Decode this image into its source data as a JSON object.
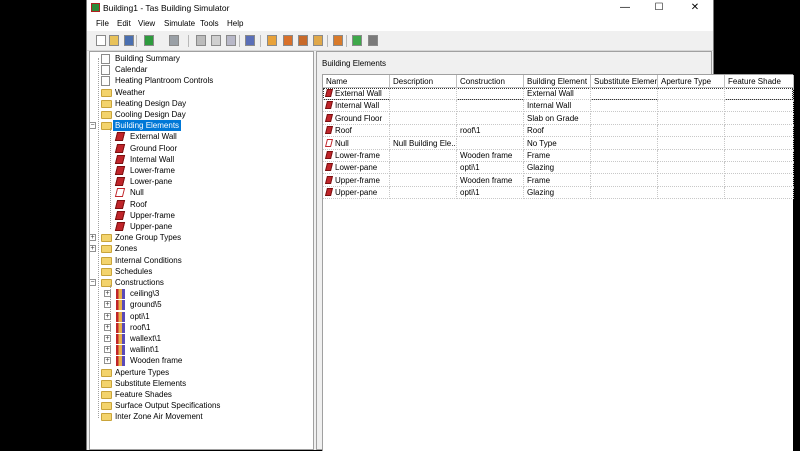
{
  "window": {
    "title": "Building1 - Tas Building Simulator"
  },
  "window_controls": {
    "minimize": "—",
    "maximize": "☐",
    "close": "✕"
  },
  "menu": [
    "File",
    "Edit",
    "View",
    "Simulate",
    "Tools",
    "Help"
  ],
  "toolbar": {
    "icons": [
      "new-file-icon",
      "open-folder-icon",
      "save-icon",
      "back-icon",
      "forward-icon",
      "cut-icon",
      "copy-icon",
      "paste-icon",
      "wizard-icon",
      "add-item-icon",
      "edit-item-icon",
      "properties-icon",
      "list-icon",
      "report-icon",
      "zone-icon",
      "refresh-icon"
    ]
  },
  "tree": {
    "root_items": [
      {
        "label": "Building Summary",
        "icon": "document-icon"
      },
      {
        "label": "Calendar",
        "icon": "calendar-icon"
      },
      {
        "label": "Heating Plantroom Controls",
        "icon": "plantroom-icon"
      },
      {
        "label": "Weather",
        "icon": "folder-icon"
      },
      {
        "label": "Heating Design Day",
        "icon": "folder-icon"
      },
      {
        "label": "Cooling Design Day",
        "icon": "folder-icon"
      },
      {
        "label": "Building Elements",
        "icon": "folder-icon",
        "expander": "⊟",
        "selected": true
      }
    ],
    "building_elements": [
      {
        "label": "External Wall",
        "icon": "building-element-icon"
      },
      {
        "label": "Ground Floor",
        "icon": "building-element-icon"
      },
      {
        "label": "Internal Wall",
        "icon": "building-element-icon"
      },
      {
        "label": "Lower-frame",
        "icon": "building-element-icon"
      },
      {
        "label": "Lower-pane",
        "icon": "building-element-icon"
      },
      {
        "label": "Null",
        "icon": "null-element-icon"
      },
      {
        "label": "Roof",
        "icon": "building-element-icon"
      },
      {
        "label": "Upper-frame",
        "icon": "building-element-icon"
      },
      {
        "label": "Upper-pane",
        "icon": "building-element-icon"
      }
    ],
    "middle_items": [
      {
        "label": "Zone Group Types",
        "expander": "⊞"
      },
      {
        "label": "Zones",
        "expander": "⊞"
      },
      {
        "label": "Internal Conditions",
        "expander": ""
      },
      {
        "label": "Schedules",
        "expander": ""
      },
      {
        "label": "Constructions",
        "expander": "⊟"
      }
    ],
    "constructions": [
      {
        "label": "ceiling\\3"
      },
      {
        "label": "ground\\5"
      },
      {
        "label": "opti\\1"
      },
      {
        "label": "roof\\1"
      },
      {
        "label": "wallext\\1"
      },
      {
        "label": "wallint\\1"
      },
      {
        "label": "Wooden frame"
      }
    ],
    "bottom_items": [
      {
        "label": "Aperture Types"
      },
      {
        "label": "Substitute Elements"
      },
      {
        "label": "Feature Shades"
      },
      {
        "label": "Surface Output Specifications"
      },
      {
        "label": "Inter Zone Air Movement"
      }
    ]
  },
  "pane": {
    "title": "Building Elements",
    "columns": [
      "Name",
      "Description",
      "Construction",
      "Building Element ...",
      "Substitute Element",
      "Aperture Type",
      "Feature Shade"
    ],
    "rows": [
      {
        "name": "External Wall",
        "description": "",
        "construction": "",
        "type": "External Wall",
        "substitute": "",
        "aperture": "",
        "shade": "",
        "icon": "building-element-icon"
      },
      {
        "name": "Internal Wall",
        "description": "",
        "construction": "",
        "type": "Internal Wall",
        "substitute": "",
        "aperture": "",
        "shade": "",
        "icon": "building-element-icon"
      },
      {
        "name": "Ground Floor",
        "description": "",
        "construction": "",
        "type": "Slab on Grade",
        "substitute": "",
        "aperture": "",
        "shade": "",
        "icon": "building-element-icon"
      },
      {
        "name": "Roof",
        "description": "",
        "construction": "roof\\1",
        "type": "Roof",
        "substitute": "",
        "aperture": "",
        "shade": "",
        "icon": "building-element-icon"
      },
      {
        "name": "Null",
        "description": "Null Building Ele...",
        "construction": "",
        "type": "No Type",
        "substitute": "",
        "aperture": "",
        "shade": "",
        "icon": "null-element-icon"
      },
      {
        "name": "Lower-frame",
        "description": "",
        "construction": "Wooden frame",
        "type": "Frame",
        "substitute": "",
        "aperture": "",
        "shade": "",
        "icon": "building-element-icon"
      },
      {
        "name": "Lower-pane",
        "description": "",
        "construction": "opti\\1",
        "type": "Glazing",
        "substitute": "",
        "aperture": "",
        "shade": "",
        "icon": "building-element-icon"
      },
      {
        "name": "Upper-frame",
        "description": "",
        "construction": "Wooden frame",
        "type": "Frame",
        "substitute": "",
        "aperture": "",
        "shade": "",
        "icon": "building-element-icon"
      },
      {
        "name": "Upper-pane",
        "description": "",
        "construction": "opti\\1",
        "type": "Glazing",
        "substitute": "",
        "aperture": "",
        "shade": "",
        "icon": "building-element-icon"
      }
    ]
  },
  "colors": {
    "selection": "#0078d7",
    "element_red": "#c0252a",
    "folder_yellow": "#f3d36c"
  }
}
